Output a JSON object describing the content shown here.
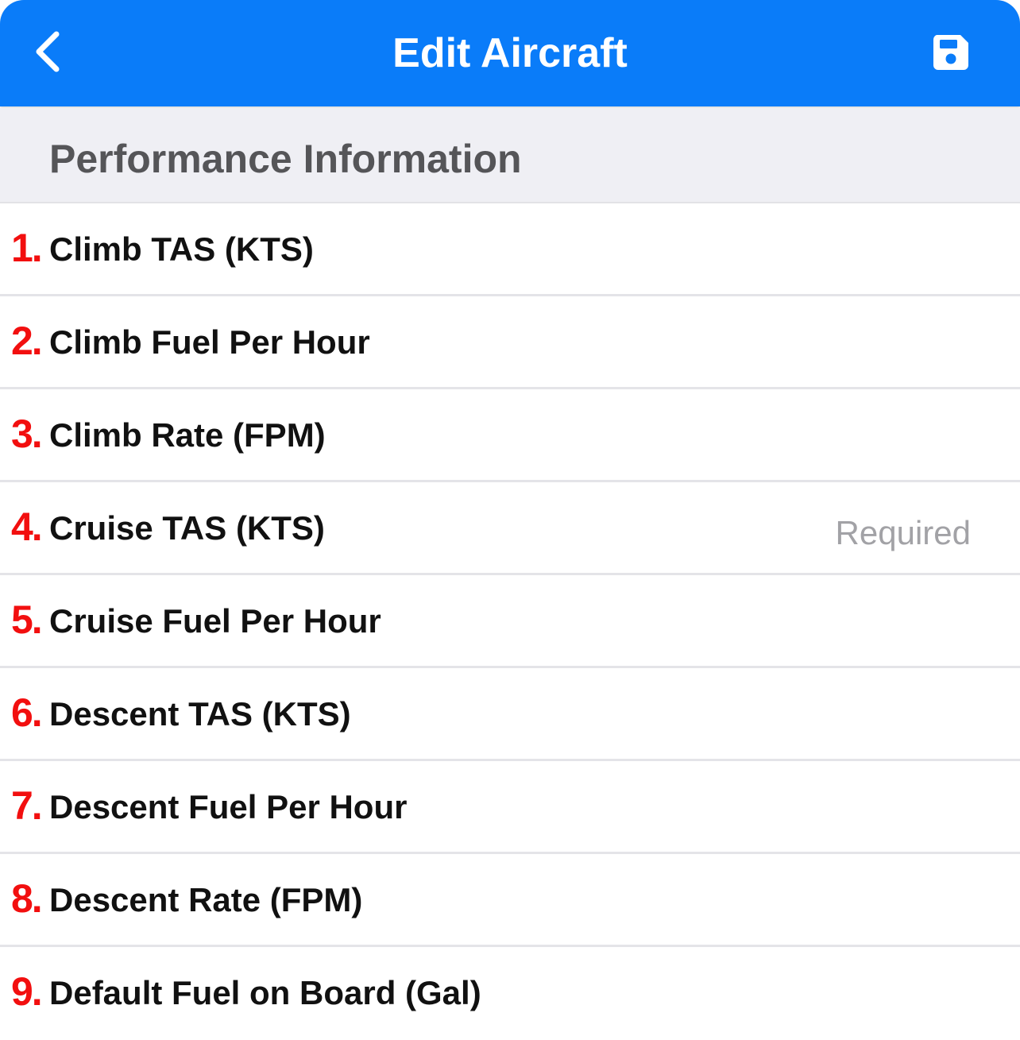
{
  "colors": {
    "nav_background": "#0a7cf9",
    "section_background": "#efeff4",
    "number_red": "#f20f0f",
    "placeholder_gray": "#a2a2a6"
  },
  "nav": {
    "title": "Edit Aircraft",
    "back_icon": "chevron-left-icon",
    "save_icon": "floppy-disk-icon"
  },
  "section": {
    "title": "Performance Information"
  },
  "rows": [
    {
      "number": "1.",
      "label": "Climb TAS (KTS)",
      "value": ""
    },
    {
      "number": "2.",
      "label": "Climb Fuel Per Hour",
      "value": ""
    },
    {
      "number": "3.",
      "label": "Climb Rate (FPM)",
      "value": ""
    },
    {
      "number": "4.",
      "label": "Cruise TAS (KTS)",
      "value": "Required"
    },
    {
      "number": "5.",
      "label": "Cruise Fuel Per Hour",
      "value": ""
    },
    {
      "number": "6.",
      "label": "Descent TAS (KTS)",
      "value": ""
    },
    {
      "number": "7.",
      "label": "Descent Fuel Per Hour",
      "value": ""
    },
    {
      "number": "8.",
      "label": "Descent Rate (FPM)",
      "value": ""
    },
    {
      "number": "9.",
      "label": "Default Fuel on Board (Gal)",
      "value": ""
    }
  ]
}
